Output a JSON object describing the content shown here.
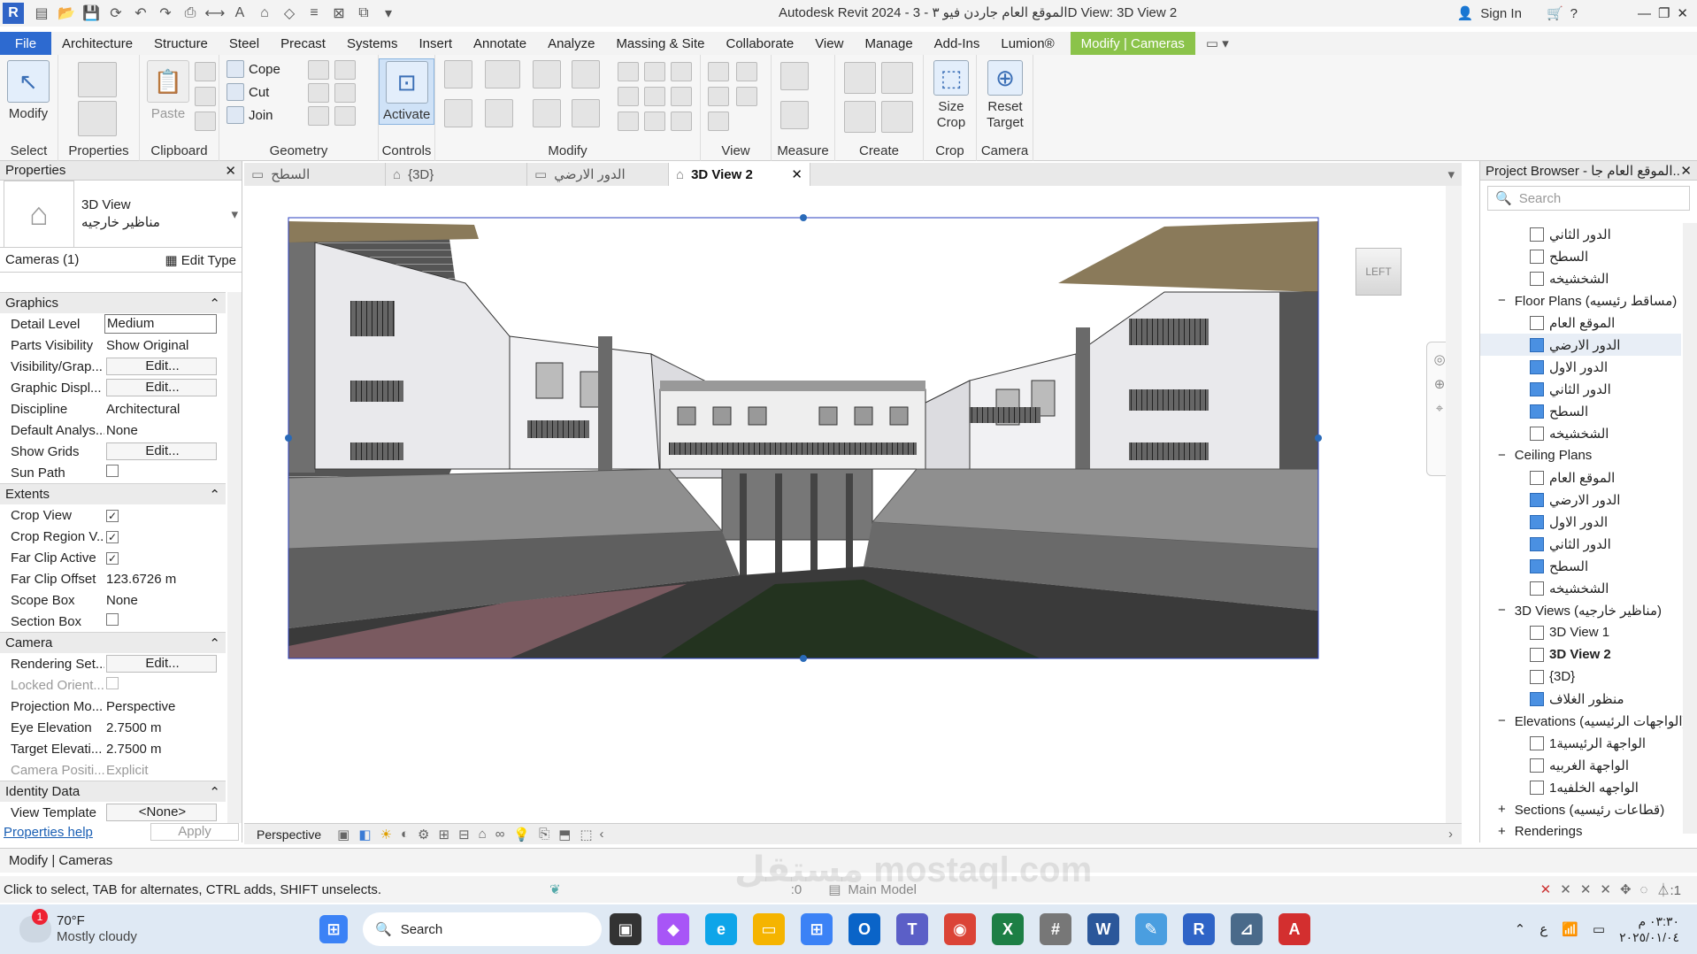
{
  "app": {
    "title": "Autodesk Revit 2024 - الموقع العام جاردن فيو ٣ - 3D View: 3D View 2",
    "sign_in": "Sign In"
  },
  "ribbon_tabs": [
    "File",
    "Architecture",
    "Structure",
    "Steel",
    "Precast",
    "Systems",
    "Insert",
    "Annotate",
    "Analyze",
    "Massing & Site",
    "Collaborate",
    "View",
    "Manage",
    "Add-Ins",
    "Lumion®",
    "Modify | Cameras"
  ],
  "ribbon": {
    "modify": "Modify",
    "select": "Select",
    "properties": "Properties",
    "clipboard": "Clipboard",
    "paste": "Paste",
    "cope": "Cope",
    "cut": "Cut",
    "join": "Join",
    "geometry": "Geometry",
    "activate": "Activate",
    "controls": "Controls",
    "modify_panel": "Modify",
    "view": "View",
    "measure": "Measure",
    "create": "Create",
    "size_crop": "Size Crop",
    "crop": "Crop",
    "reset_target": "Reset Target",
    "camera": "Camera"
  },
  "properties": {
    "title": "Properties",
    "type_name": "3D View",
    "type_sub": "مناظير خارجيه",
    "selector": "Cameras (1)",
    "edit_type": "Edit Type",
    "sections": {
      "graphics": "Graphics",
      "extents": "Extents",
      "camera": "Camera",
      "identity": "Identity Data"
    },
    "rows": {
      "detail_level": [
        "Detail Level",
        "Medium"
      ],
      "parts_visibility": [
        "Parts Visibility",
        "Show Original"
      ],
      "visibility_graphics": [
        "Visibility/Grap...",
        "Edit..."
      ],
      "graphic_display": [
        "Graphic Displ...",
        "Edit..."
      ],
      "discipline": [
        "Discipline",
        "Architectural"
      ],
      "default_analysis": [
        "Default Analys...",
        "None"
      ],
      "show_grids": [
        "Show Grids",
        "Edit..."
      ],
      "sun_path": [
        "Sun Path",
        ""
      ],
      "crop_view": [
        "Crop View",
        "✓"
      ],
      "crop_region_visible": [
        "Crop Region V...",
        "✓"
      ],
      "far_clip_active": [
        "Far Clip Active",
        "✓"
      ],
      "far_clip_offset": [
        "Far Clip Offset",
        "123.6726 m"
      ],
      "scope_box": [
        "Scope Box",
        "None"
      ],
      "section_box": [
        "Section Box",
        ""
      ],
      "rendering_settings": [
        "Rendering Set...",
        "Edit..."
      ],
      "locked_orientation": [
        "Locked Orient...",
        ""
      ],
      "projection_mode": [
        "Projection Mo...",
        "Perspective"
      ],
      "eye_elevation": [
        "Eye Elevation",
        "2.7500 m"
      ],
      "target_elevation": [
        "Target Elevati...",
        "2.7500 m"
      ],
      "camera_position": [
        "Camera Positi...",
        "Explicit"
      ],
      "view_template": [
        "View Template",
        "<None>"
      ]
    },
    "help": "Properties help",
    "apply": "Apply"
  },
  "view_tabs": [
    {
      "label": "السطح"
    },
    {
      "label": "{3D}"
    },
    {
      "label": "الدور الارضي"
    },
    {
      "label": "3D View 2"
    }
  ],
  "viewcube": {
    "face": "LEFT"
  },
  "view_bar": {
    "mode": "Perspective"
  },
  "project_browser": {
    "title": "Project Browser - الموقع العام جا...",
    "search_placeholder": "Search",
    "items": [
      {
        "text": "الدور الثاني",
        "level": 2,
        "icon": "white"
      },
      {
        "text": "السطح",
        "level": 2,
        "icon": "white"
      },
      {
        "text": "الشخشيخه",
        "level": 2,
        "icon": "white"
      },
      {
        "text": "Floor Plans (مساقط رئيسيه)",
        "level": 1,
        "icon": "none",
        "exp": "−"
      },
      {
        "text": "الموقع العام",
        "level": 2,
        "icon": "white"
      },
      {
        "text": "الدور الارضي",
        "level": 2,
        "icon": "blue",
        "sel": true
      },
      {
        "text": "الدور الاول",
        "level": 2,
        "icon": "blue"
      },
      {
        "text": "الدور الثاني",
        "level": 2,
        "icon": "blue"
      },
      {
        "text": "السطح",
        "level": 2,
        "icon": "blue"
      },
      {
        "text": "الشخشيخه",
        "level": 2,
        "icon": "white"
      },
      {
        "text": "Ceiling Plans",
        "level": 1,
        "icon": "none",
        "exp": "−"
      },
      {
        "text": "الموقع العام",
        "level": 2,
        "icon": "white"
      },
      {
        "text": "الدور الارضي",
        "level": 2,
        "icon": "blue"
      },
      {
        "text": "الدور الاول",
        "level": 2,
        "icon": "blue"
      },
      {
        "text": "الدور الثاني",
        "level": 2,
        "icon": "blue"
      },
      {
        "text": "السطح",
        "level": 2,
        "icon": "blue"
      },
      {
        "text": "الشخشيخه",
        "level": 2,
        "icon": "white"
      },
      {
        "text": "3D Views (مناظير خارجيه)",
        "level": 1,
        "icon": "none",
        "exp": "−"
      },
      {
        "text": "3D View 1",
        "level": 2,
        "icon": "white"
      },
      {
        "text": "3D View 2",
        "level": 2,
        "icon": "white",
        "bold": true
      },
      {
        "text": "{3D}",
        "level": 2,
        "icon": "white"
      },
      {
        "text": "منظور الغلاف",
        "level": 2,
        "icon": "blue"
      },
      {
        "text": "Elevations (الواجهات الرئيسيه)",
        "level": 1,
        "icon": "none",
        "exp": "−"
      },
      {
        "text": "الواجهة الرئيسية1",
        "level": 2,
        "icon": "white"
      },
      {
        "text": "الواجهة الغربيه",
        "level": 2,
        "icon": "white"
      },
      {
        "text": "الواجهه الخلفيه1",
        "level": 2,
        "icon": "white"
      },
      {
        "text": "Sections (قطاعات رئيسيه)",
        "level": 1,
        "icon": "none",
        "exp": "+"
      },
      {
        "text": "Renderings",
        "level": 1,
        "icon": "none",
        "exp": "+"
      }
    ]
  },
  "status": {
    "context": "Modify | Cameras",
    "hint": "Click to select, TAB for alternates, CTRL adds, SHIFT unselects.",
    "zero": ":0",
    "model": "Main Model",
    "filter": ":1"
  },
  "taskbar": {
    "temp": "70°F",
    "weather": "Mostly cloudy",
    "search": "Search",
    "time": "٠٣:٣٠ م",
    "date": "٢٠٢٥/٠١/٠٤",
    "lang": "ع",
    "badge": "1"
  },
  "watermark": "مستقل mostaql.com"
}
